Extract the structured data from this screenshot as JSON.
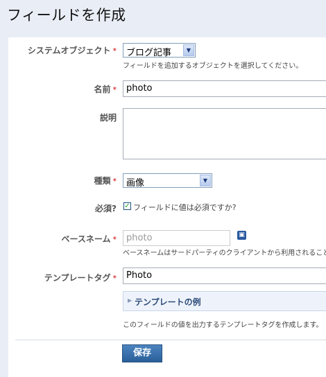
{
  "page": {
    "title": "フィールドを作成"
  },
  "required_mark": "*",
  "fields": {
    "system_object": {
      "label": "システムオブジェクト",
      "value": "ブログ記事",
      "hint": "フィールドを追加するオブジェクトを選択してください。"
    },
    "name": {
      "label": "名前",
      "value": "photo"
    },
    "description": {
      "label": "説明",
      "value": ""
    },
    "type": {
      "label": "種類",
      "value": "画像"
    },
    "required": {
      "label": "必須?",
      "checkbox_label": "フィールドに値は必須ですか?",
      "checked": true
    },
    "basename": {
      "label": "ベースネーム",
      "placeholder": "photo",
      "hint": "ベースネームはサードパーティのクライアントから利用されること"
    },
    "template_tag": {
      "label": "テンプレートタグ",
      "value": "Photo",
      "example_label": "テンプレートの例",
      "hint": "このフィールドの値を出力するテンプレートタグを作成します。"
    }
  },
  "actions": {
    "save_label": "保存"
  },
  "icons": {
    "select_arrow": "chevron-down-icon",
    "lock": "lock-icon",
    "expand": "triangle-right-icon",
    "checkmark": "check-icon"
  },
  "colors": {
    "accent": "#2a5f99",
    "background": "#e9eef6",
    "required": "#cc0000"
  }
}
